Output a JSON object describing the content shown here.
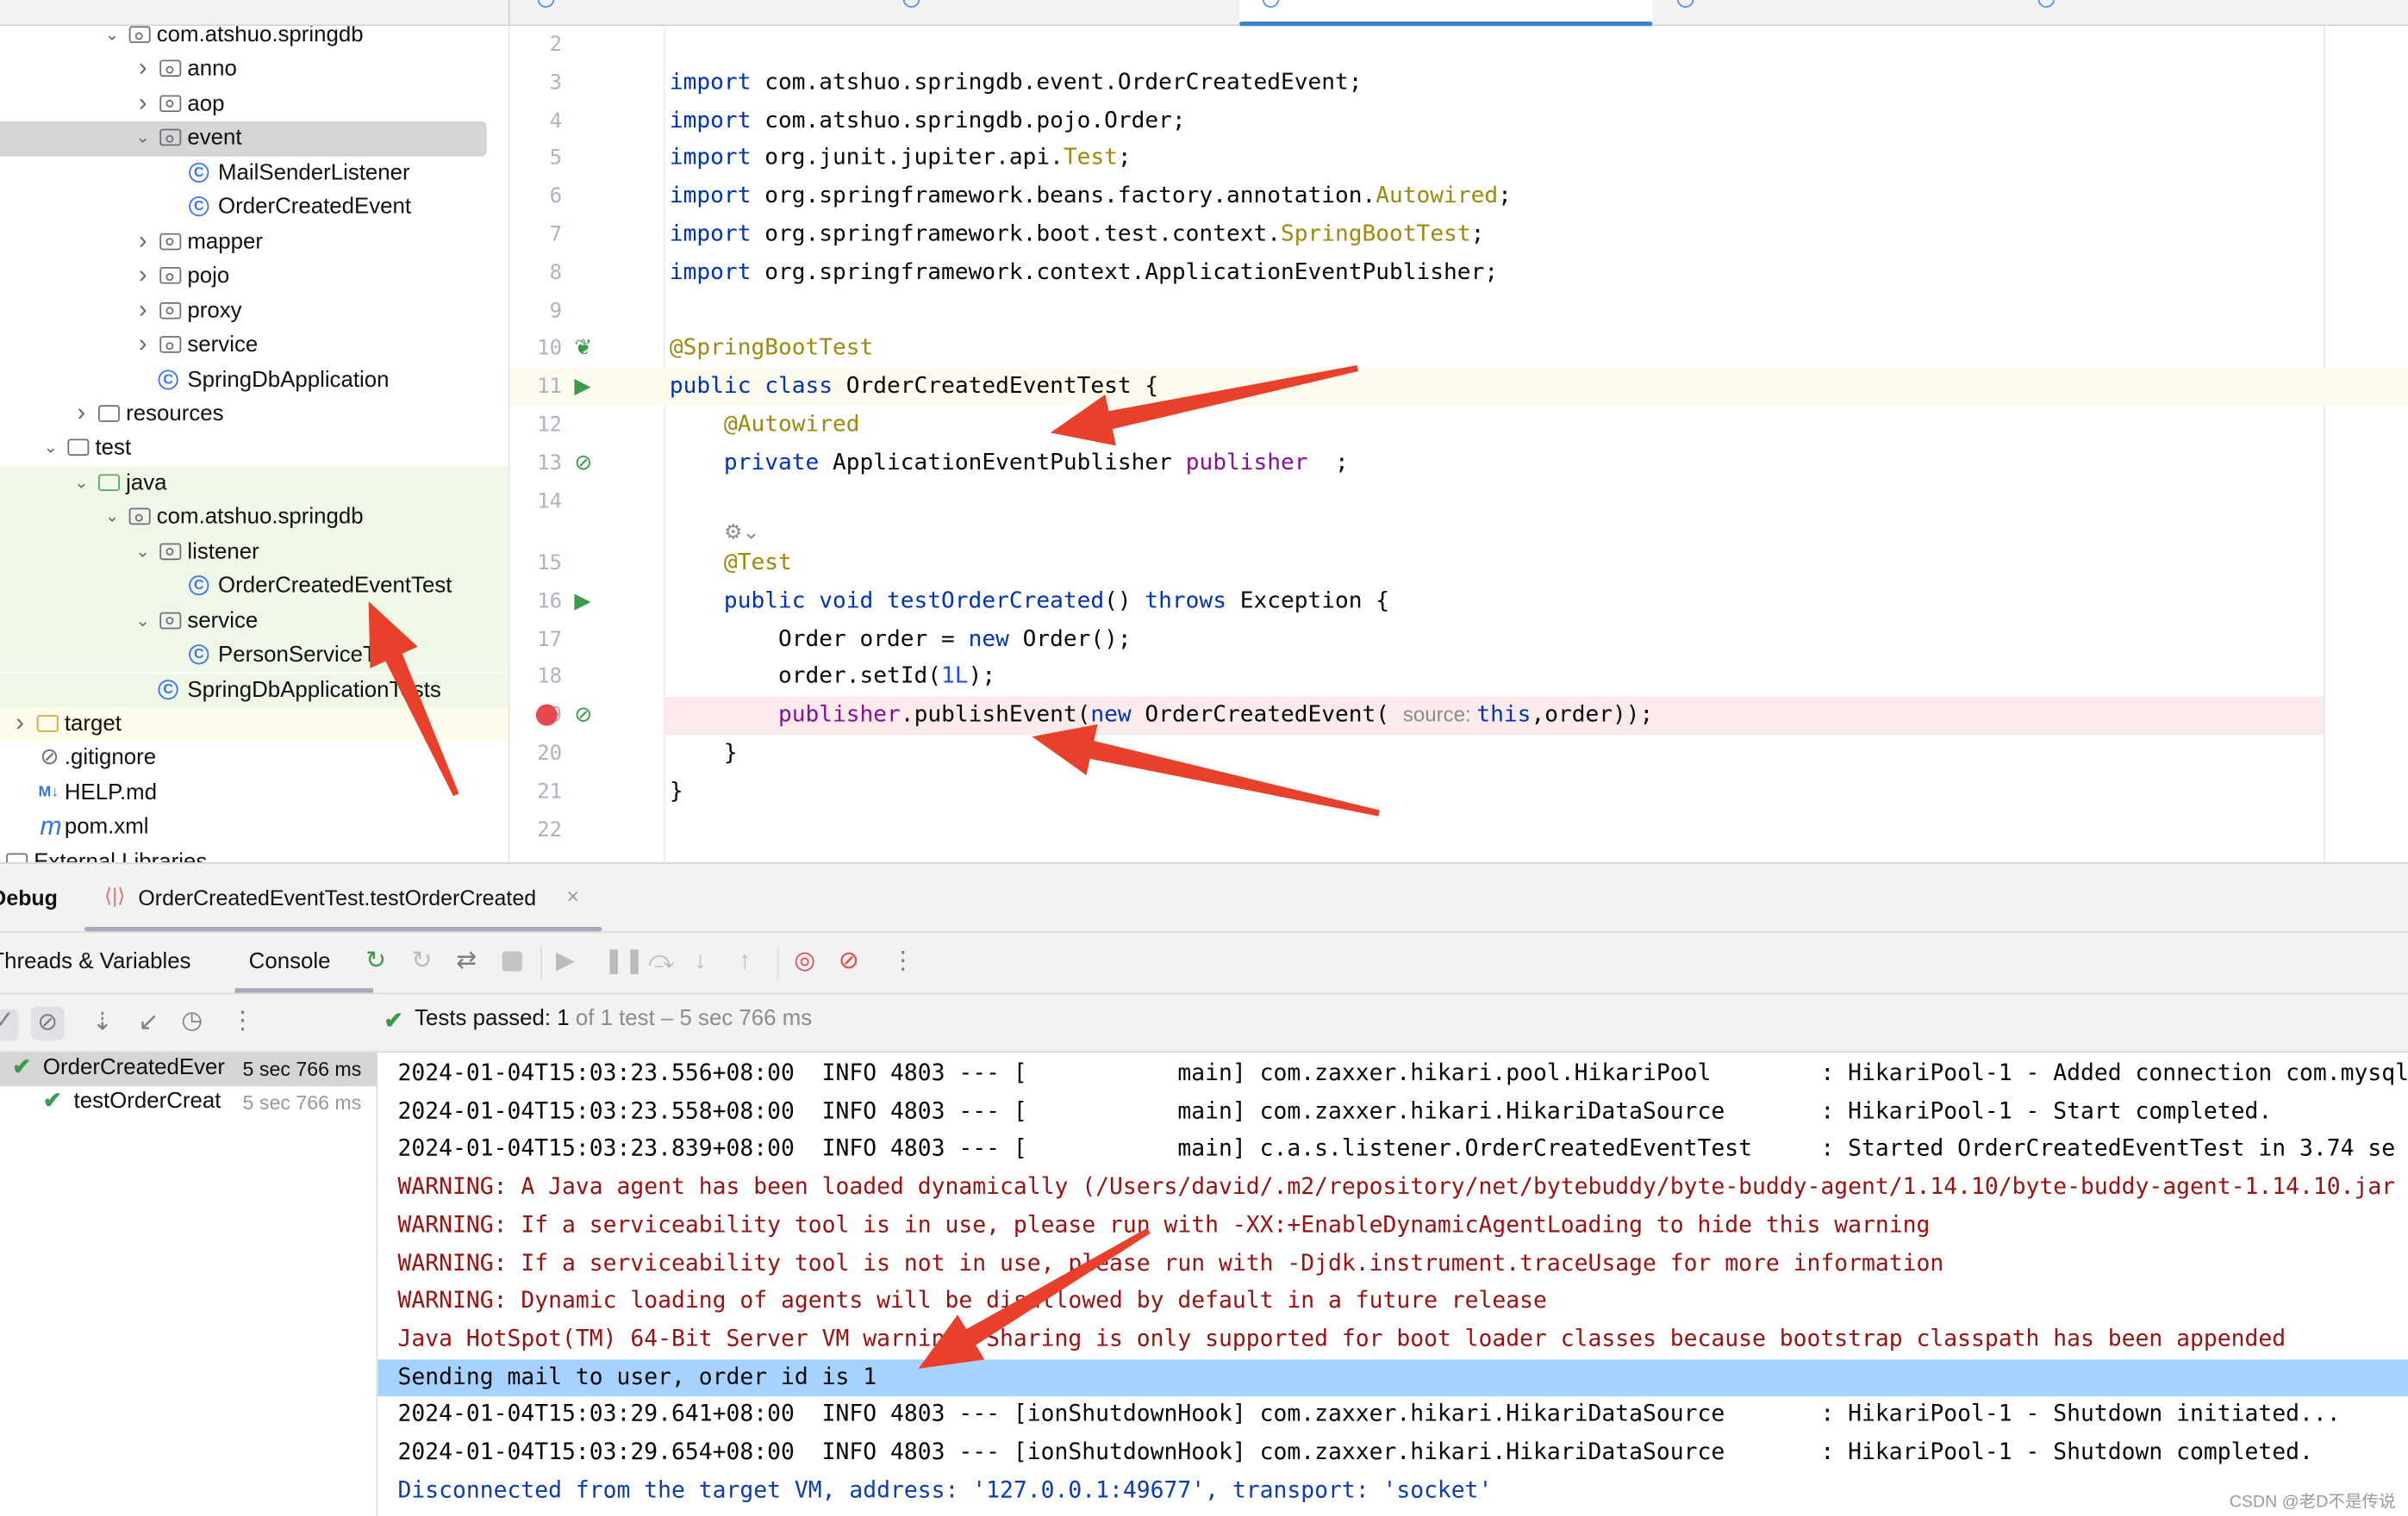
{
  "editor_tabs": [
    {
      "label": ""
    },
    {
      "label": ""
    },
    {
      "label": "",
      "active": true
    },
    {
      "label": ""
    },
    {
      "label": ""
    }
  ],
  "project_tree": [
    {
      "label": "com.atshuo.springdb",
      "level": 3,
      "icon": "package",
      "chevron": "down"
    },
    {
      "label": "anno",
      "level": 4,
      "icon": "package",
      "chevron": "right"
    },
    {
      "label": "aop",
      "level": 4,
      "icon": "package",
      "chevron": "right"
    },
    {
      "label": "event",
      "level": 4,
      "icon": "package",
      "chevron": "down",
      "selected": true
    },
    {
      "label": "MailSenderListener",
      "level": 5,
      "icon": "class"
    },
    {
      "label": "OrderCreatedEvent",
      "level": 5,
      "icon": "class"
    },
    {
      "label": "mapper",
      "level": 4,
      "icon": "package",
      "chevron": "right"
    },
    {
      "label": "pojo",
      "level": 4,
      "icon": "package",
      "chevron": "right"
    },
    {
      "label": "proxy",
      "level": 4,
      "icon": "package",
      "chevron": "right"
    },
    {
      "label": "service",
      "level": 4,
      "icon": "package",
      "chevron": "right"
    },
    {
      "label": "SpringDbApplication",
      "level": 4,
      "icon": "spring-class"
    },
    {
      "label": "resources",
      "level": 2,
      "icon": "resources-folder",
      "chevron": "right"
    },
    {
      "label": "test",
      "level": 1,
      "icon": "folder",
      "chevron": "down"
    },
    {
      "label": "java",
      "level": 2,
      "icon": "test-folder",
      "chevron": "down",
      "bg": "test"
    },
    {
      "label": "com.atshuo.springdb",
      "level": 3,
      "icon": "package",
      "chevron": "down",
      "bg": "test"
    },
    {
      "label": "listener",
      "level": 4,
      "icon": "package",
      "chevron": "down",
      "bg": "test"
    },
    {
      "label": "OrderCreatedEventTest",
      "level": 5,
      "icon": "class",
      "bg": "test"
    },
    {
      "label": "service",
      "level": 4,
      "icon": "package",
      "chevron": "down",
      "bg": "test"
    },
    {
      "label": "PersonServiceTest",
      "level": 5,
      "icon": "class",
      "bg": "test"
    },
    {
      "label": "SpringDbApplicationTests",
      "level": 4,
      "icon": "spring-class",
      "bg": "test"
    },
    {
      "label": "target",
      "level": 0,
      "icon": "excluded-folder",
      "chevron": "right",
      "bg": "excluded"
    },
    {
      "label": ".gitignore",
      "level": 0,
      "icon": "ignore-file"
    },
    {
      "label": "HELP.md",
      "level": 0,
      "icon": "markdown-file"
    },
    {
      "label": "pom.xml",
      "level": 0,
      "icon": "maven-file"
    },
    {
      "label": "External Libraries",
      "level": -1,
      "icon": "library",
      "chevron": "right"
    }
  ],
  "code_lines": [
    {
      "n": "2",
      "tokens": []
    },
    {
      "n": "3",
      "tokens": [
        [
          "import ",
          "kw"
        ],
        [
          "com.atshuo.springdb.event.OrderCreatedEvent;",
          "pl"
        ]
      ]
    },
    {
      "n": "4",
      "tokens": [
        [
          "import ",
          "kw"
        ],
        [
          "com.atshuo.springdb.pojo.Order;",
          "pl"
        ]
      ]
    },
    {
      "n": "5",
      "tokens": [
        [
          "import ",
          "kw"
        ],
        [
          "org.junit.jupiter.api.",
          "pl"
        ],
        [
          "Test",
          "an"
        ],
        [
          ";",
          "pl"
        ]
      ]
    },
    {
      "n": "6",
      "tokens": [
        [
          "import ",
          "kw"
        ],
        [
          "org.springframework.beans.factory.annotation.",
          "pl"
        ],
        [
          "Autowired",
          "an"
        ],
        [
          ";",
          "pl"
        ]
      ]
    },
    {
      "n": "7",
      "tokens": [
        [
          "import ",
          "kw"
        ],
        [
          "org.springframework.boot.test.context.",
          "pl"
        ],
        [
          "SpringBootTest",
          "an"
        ],
        [
          ";",
          "pl"
        ]
      ]
    },
    {
      "n": "8",
      "tokens": [
        [
          "import ",
          "kw"
        ],
        [
          "org.springframework.context.ApplicationEventPublisher;",
          "pl"
        ]
      ]
    },
    {
      "n": "9",
      "tokens": []
    },
    {
      "n": "10",
      "tokens": [
        [
          "@SpringBootTest",
          "an"
        ]
      ],
      "gutter": "spring-bean-icon"
    },
    {
      "n": "11",
      "tokens": [
        [
          "public class ",
          "kw"
        ],
        [
          "OrderCreatedEventTest {",
          "pl"
        ]
      ],
      "gutter": "run-test-icon",
      "highlight": "current"
    },
    {
      "n": "12",
      "tokens": [
        [
          "    @Autowired",
          "an"
        ]
      ]
    },
    {
      "n": "13",
      "tokens": [
        [
          "    private ",
          "kw"
        ],
        [
          "ApplicationEventPublisher ",
          "pl"
        ],
        [
          "publisher",
          "fd"
        ],
        [
          "  ;",
          "pl"
        ]
      ],
      "gutter": "autowired-bean-icon"
    },
    {
      "n": "14",
      "tokens": []
    },
    {
      "n": "",
      "tokens": [
        [
          "    ",
          "pl"
        ],
        [
          "⚙⌄",
          "ht"
        ]
      ],
      "inlay": true
    },
    {
      "n": "15",
      "tokens": [
        [
          "    @Test",
          "an"
        ]
      ]
    },
    {
      "n": "16",
      "tokens": [
        [
          "    public void ",
          "kw"
        ],
        [
          "testOrderCreated",
          "kw"
        ],
        [
          "() ",
          "pl"
        ],
        [
          "throws ",
          "kw"
        ],
        [
          "Exception {",
          "pl"
        ]
      ],
      "gutter": "run-test-icon"
    },
    {
      "n": "17",
      "tokens": [
        [
          "        Order order = ",
          "pl"
        ],
        [
          "new ",
          "kw"
        ],
        [
          "Order();",
          "pl"
        ]
      ]
    },
    {
      "n": "18",
      "tokens": [
        [
          "        order.setId(",
          "pl"
        ],
        [
          "1L",
          "nm"
        ],
        [
          ");",
          "pl"
        ]
      ]
    },
    {
      "n": "19",
      "tokens": [
        [
          "        ",
          "pl"
        ],
        [
          "publisher",
          "fd"
        ],
        [
          ".publishEvent(",
          "pl"
        ],
        [
          "new ",
          "kw"
        ],
        [
          "OrderCreatedEvent( ",
          "pl"
        ],
        [
          "source: ",
          "ht"
        ],
        [
          "this",
          "kw"
        ],
        [
          ",order));",
          "pl"
        ]
      ],
      "breakpoint": true,
      "gutter": "event-icon",
      "highlight": "breakpoint"
    },
    {
      "n": "20",
      "tokens": [
        [
          "    }",
          "pl"
        ]
      ]
    },
    {
      "n": "21",
      "tokens": [
        [
          "}",
          "pl"
        ]
      ]
    },
    {
      "n": "22",
      "tokens": []
    }
  ],
  "debug": {
    "title": "Debug",
    "session_tab": "OrderCreatedEventTest.testOrderCreated",
    "subtabs": [
      "Threads & Variables",
      "Console"
    ],
    "active_subtab": "Console",
    "tests_passed_label": "Tests passed: ",
    "tests_passed_count": "1",
    "tests_summary": " of 1 test – 5 sec 766 ms",
    "test_tree": [
      {
        "label": "OrderCreatedEver",
        "time": "5 sec 766 ms",
        "selected": true
      },
      {
        "label": "testOrderCreat",
        "time": "5 sec 766 ms"
      }
    ]
  },
  "console_lines": [
    {
      "text": "2024-01-04T15:03:23.556+08:00  INFO 4803 --- [           main] com.zaxxer.hikari.pool.HikariPool        : HikariPool-1 - Added connection com.mysql",
      "type": "info"
    },
    {
      "text": "2024-01-04T15:03:23.558+08:00  INFO 4803 --- [           main] com.zaxxer.hikari.HikariDataSource       : HikariPool-1 - Start completed.",
      "type": "info"
    },
    {
      "text": "2024-01-04T15:03:23.839+08:00  INFO 4803 --- [           main] c.a.s.listener.OrderCreatedEventTest     : Started OrderCreatedEventTest in 3.74 se",
      "type": "info"
    },
    {
      "text": "WARNING: A Java agent has been loaded dynamically (/Users/david/.m2/repository/net/bytebuddy/byte-buddy-agent/1.14.10/byte-buddy-agent-1.14.10.jar",
      "type": "warn"
    },
    {
      "text": "WARNING: If a serviceability tool is in use, please run with -XX:+EnableDynamicAgentLoading to hide this warning",
      "type": "warn"
    },
    {
      "text": "WARNING: If a serviceability tool is not in use, please run with -Djdk.instrument.traceUsage for more information",
      "type": "warn"
    },
    {
      "text": "WARNING: Dynamic loading of agents will be disallowed by default in a future release",
      "type": "warn"
    },
    {
      "text": "Java HotSpot(TM) 64-Bit Server VM warning: Sharing is only supported for boot loader classes because bootstrap classpath has been appended",
      "type": "warn"
    },
    {
      "text": "Sending mail to user, order id is 1",
      "type": "info",
      "selected": true
    },
    {
      "text": "2024-01-04T15:03:29.641+08:00  INFO 4803 --- [ionShutdownHook] com.zaxxer.hikari.HikariDataSource       : HikariPool-1 - Shutdown initiated...",
      "type": "info"
    },
    {
      "text": "2024-01-04T15:03:29.654+08:00  INFO 4803 --- [ionShutdownHook] com.zaxxer.hikari.HikariDataSource       : HikariPool-1 - Shutdown completed.",
      "type": "info"
    },
    {
      "text": "Disconnected from the target VM, address: '127.0.0.1:49677', transport: 'socket'",
      "type": "sys"
    }
  ],
  "watermark": "CSDN @老D不是传说",
  "colors": {
    "accent": "#3d84cf",
    "annotation_arrow": "#e8402a",
    "selection": "#a6d2ff",
    "test_bg": "#eff8e7",
    "current_line": "#fcfaed",
    "breakpoint_line": "#fbeaea"
  }
}
